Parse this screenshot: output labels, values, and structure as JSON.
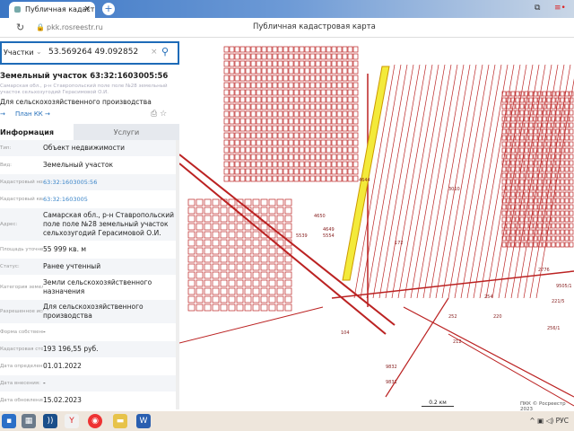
{
  "browser": {
    "tab_title": "Публичная кадастровая карта",
    "url": "pkk.rosreestr.ru",
    "page_title": "Публичная кадастровая карта"
  },
  "search": {
    "category": "Участки",
    "query": "53.569264 49.092852"
  },
  "parcel": {
    "title": "Земельный участок 63:32:1603005:56",
    "address_short": "Самарская обл., р-н Ставропольский поле поле №28 земельный участок сельхозугодий Герасимовой О.И.",
    "use": "Для сельскохозяйственного производства",
    "plan_link": "План КК"
  },
  "tabs": {
    "info": "Информация",
    "services": "Услуги"
  },
  "rows": [
    {
      "k": "Тип:",
      "v": "Объект недвижимости"
    },
    {
      "k": "Вид:",
      "v": "Земельный участок"
    },
    {
      "k": "Кадастровый номер:",
      "v": "63:32:1603005:56",
      "link": true
    },
    {
      "k": "Кадастровый квартал:",
      "v": "63:32:1603005",
      "link": true
    },
    {
      "k": "Адрес:",
      "v": "Самарская обл., р-н Ставропольский поле поле №28 земельный участок сельхозугодий Герасимовой О.И."
    },
    {
      "k": "Площадь уточненная:",
      "v": "55 999 кв. м"
    },
    {
      "k": "Статус:",
      "v": "Ранее учтенный"
    },
    {
      "k": "Категория земель:",
      "v": "Земли сельскохозяйственного назначения"
    },
    {
      "k": "Разрешенное использование:",
      "v": "Для сельскохозяйственного производства"
    },
    {
      "k": "Форма собственности:",
      "v": "-"
    },
    {
      "k": "Кадастровая стоимость:",
      "v": "193 196,55 руб."
    },
    {
      "k": "Дата определения:",
      "v": "01.01.2022"
    },
    {
      "k": "Дата внесения:",
      "v": "-"
    },
    {
      "k": "Дата обновления сведений:",
      "v": "15.02.2023"
    }
  ],
  "map": {
    "labels": [
      "5539",
      "4644",
      "4650",
      "4649",
      "5554",
      "254",
      "252",
      "220",
      "256/1",
      "212",
      "104",
      "9832",
      "9831",
      "9505/1",
      "221/5",
      "2776",
      "3010",
      "172"
    ],
    "scale": "0.2 км",
    "copyright": "ПКК © Росреестр 2023"
  },
  "taskbar": {
    "lang": "РУС"
  }
}
